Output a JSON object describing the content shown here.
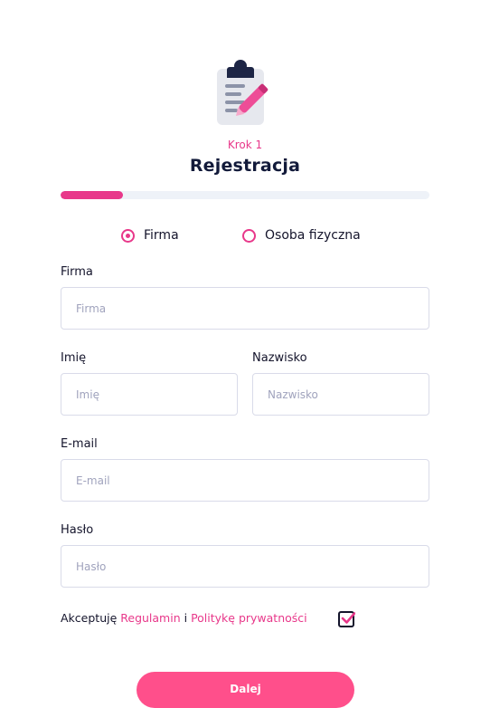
{
  "header": {
    "logo_icon": "clipboard-pencil-icon",
    "step": "Krok 1",
    "title": "Rejestracja",
    "progress_fraction": 0.17
  },
  "account_type": {
    "options": [
      {
        "label": "Firma",
        "selected": true
      },
      {
        "label": "Osoba fizyczna",
        "selected": false
      }
    ]
  },
  "fields": {
    "company": {
      "label": "Firma",
      "placeholder": "Firma",
      "value": ""
    },
    "first_name": {
      "label": "Imię",
      "placeholder": "Imię",
      "value": ""
    },
    "last_name": {
      "label": "Nazwisko",
      "placeholder": "Nazwisko",
      "value": ""
    },
    "email": {
      "label": "E-mail",
      "placeholder": "E-mail",
      "value": ""
    },
    "password": {
      "label": "Hasło",
      "placeholder": "Hasło",
      "value": ""
    }
  },
  "consent": {
    "prefix": "Akceptuję ",
    "terms_link": "Regulamin",
    "conjunction": " i ",
    "privacy_link": "Politykę prywatności",
    "checked": true
  },
  "submit_label": "Dalej",
  "colors": {
    "accent": "#e8388a",
    "button": "#ff4f8b",
    "title": "#121a3a",
    "border": "#d9dbe9"
  }
}
